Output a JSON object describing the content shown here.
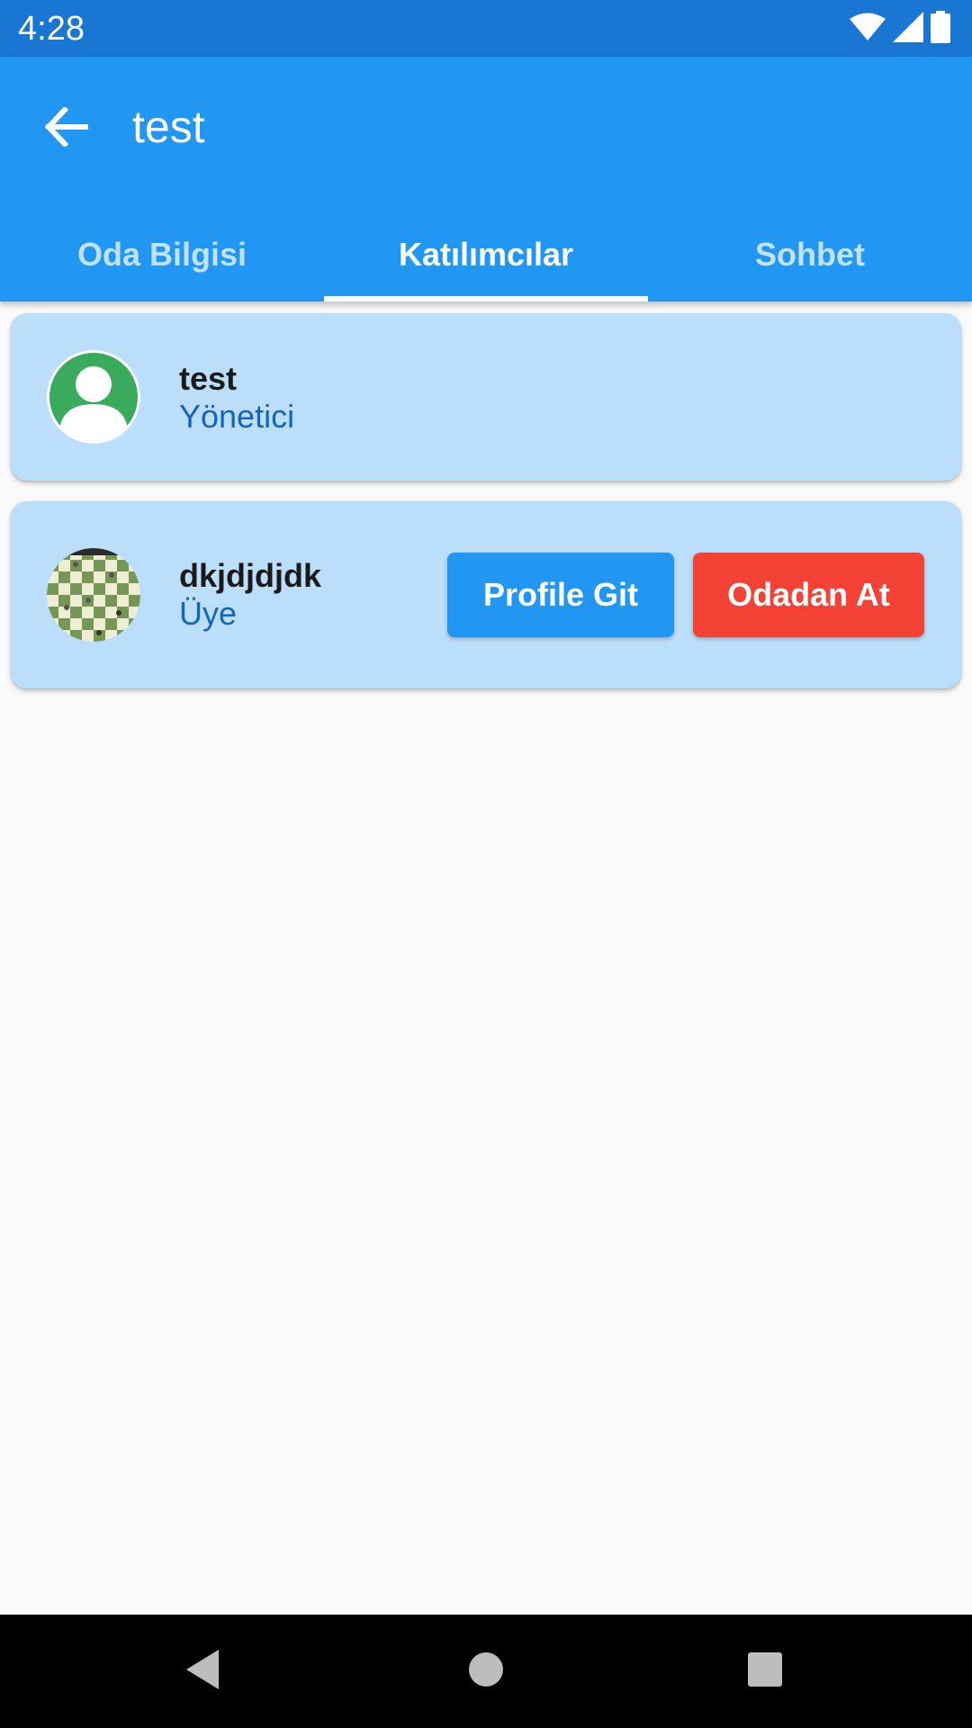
{
  "status_bar": {
    "time": "4:28",
    "icons": [
      "wifi-icon",
      "signal-icon",
      "battery-icon"
    ]
  },
  "app_bar": {
    "title": "test",
    "back_icon": "arrow-back-icon"
  },
  "tabs": [
    {
      "label": "Oda Bilgisi",
      "active": false
    },
    {
      "label": "Katılımcılar",
      "active": true
    },
    {
      "label": "Sohbet",
      "active": false
    }
  ],
  "participants": [
    {
      "name": "test",
      "role": "Yönetici",
      "avatar": "default-person-avatar"
    },
    {
      "name": "dkjdjdjdk",
      "role": "Üye",
      "avatar": "chessboard-avatar",
      "actions": {
        "profile_label": "Profile Git",
        "kick_label": "Odadan At"
      }
    }
  ],
  "nav_bar": {
    "icons": [
      "back-triangle-icon",
      "home-circle-icon",
      "recents-square-icon"
    ]
  },
  "colors": {
    "status_bar": "#1976d2",
    "app_bar": "#2196f3",
    "card_bg": "#bbdefb",
    "role_text": "#1565c0",
    "primary_button": "#2196f3",
    "danger_button": "#f44336",
    "avatar_green": "#3aaa5c"
  }
}
